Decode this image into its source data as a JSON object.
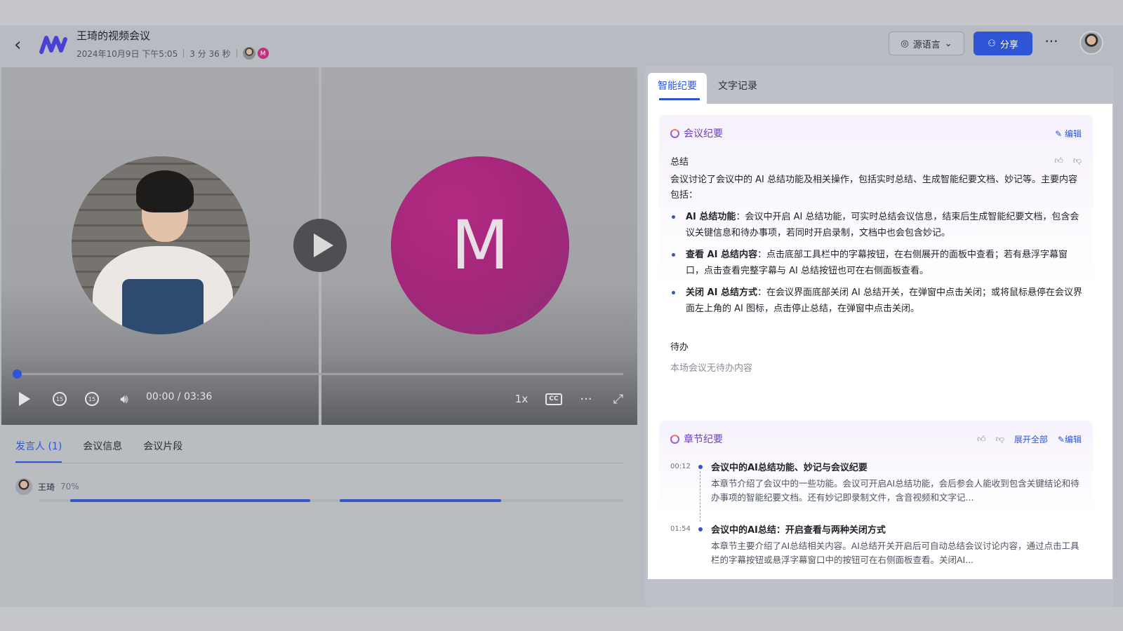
{
  "header": {
    "back_icon": "chevron-left-icon",
    "logo_icon": "meeting-logo-icon",
    "title": "王琦的视频会议",
    "date": "2024年10月9日 下午5:05",
    "duration": "3 分 36 秒",
    "participant_initial": "M",
    "lang_label": "源语言",
    "share_label": "分享",
    "more_label": "···"
  },
  "video": {
    "avatar_letter": "M",
    "time": "00:00 / 03:36",
    "speed": "1x",
    "cc": "CC",
    "rewind_label": "15",
    "forward_label": "15",
    "progress": 0
  },
  "left_tabs": [
    {
      "label": "发言人 (1)"
    },
    {
      "label": "会议信息"
    },
    {
      "label": "会议片段"
    }
  ],
  "speaker": {
    "name": "王琦",
    "percent": "70%"
  },
  "right_tabs": [
    {
      "label": "智能纪要"
    },
    {
      "label": "文字记录"
    }
  ],
  "summary": {
    "heading": "会议纪要",
    "edit": "编辑",
    "summary_label": "总结",
    "intro": "会议讨论了会议中的 AI 总结功能及相关操作，包括实时总结、生成智能纪要文档、妙记等。主要内容包括：",
    "bullets": [
      {
        "bold": "AI 总结功能",
        "text": "：会议中开启 AI 总结功能，可实时总结会议信息，结束后生成智能纪要文档，包含会议关键信息和待办事项，若同时开启录制，文档中也会包含妙记。"
      },
      {
        "bold": "查看 AI 总结内容",
        "text": "：点击底部工具栏中的字幕按钮，在右侧展开的面板中查看；若有悬浮字幕窗口，点击查看完整字幕与 AI 总结按钮也可在右侧面板查看。"
      },
      {
        "bold": "关闭 AI 总结方式",
        "text": "：在会议界面底部关闭 AI 总结开关，在弹窗中点击关闭；或将鼠标悬停在会议界面左上角的 AI 图标，点击停止总结，在弹窗中点击关闭。"
      }
    ],
    "todo_label": "待办",
    "todo_empty": "本场会议无待办内容"
  },
  "chapters": {
    "heading": "章节纪要",
    "expand_all": "展开全部",
    "edit": "编辑",
    "items": [
      {
        "time": "00:12",
        "title": "会议中的AI总结功能、妙记与会议纪要",
        "desc": "本章节介绍了会议中的一些功能。会议可开启AI总结功能，会后参会人能收到包含关键结论和待办事项的智能纪要文档。还有妙记即录制文件，含音视频和文字记..."
      },
      {
        "time": "01:54",
        "title": "会议中的AI总结：开启查看与两种关闭方式",
        "desc": "本章节主要介绍了AI总结相关内容。AI总结开关开启后可自动总结会议讨论内容，通过点击工具栏的字幕按钮或悬浮字幕窗口中的按钮可在右侧面板查看。关闭AI..."
      }
    ]
  },
  "colors": {
    "accent": "#2d55d6",
    "avatar_m": "#a4267a",
    "ai_purple": "#6c3fb5"
  }
}
